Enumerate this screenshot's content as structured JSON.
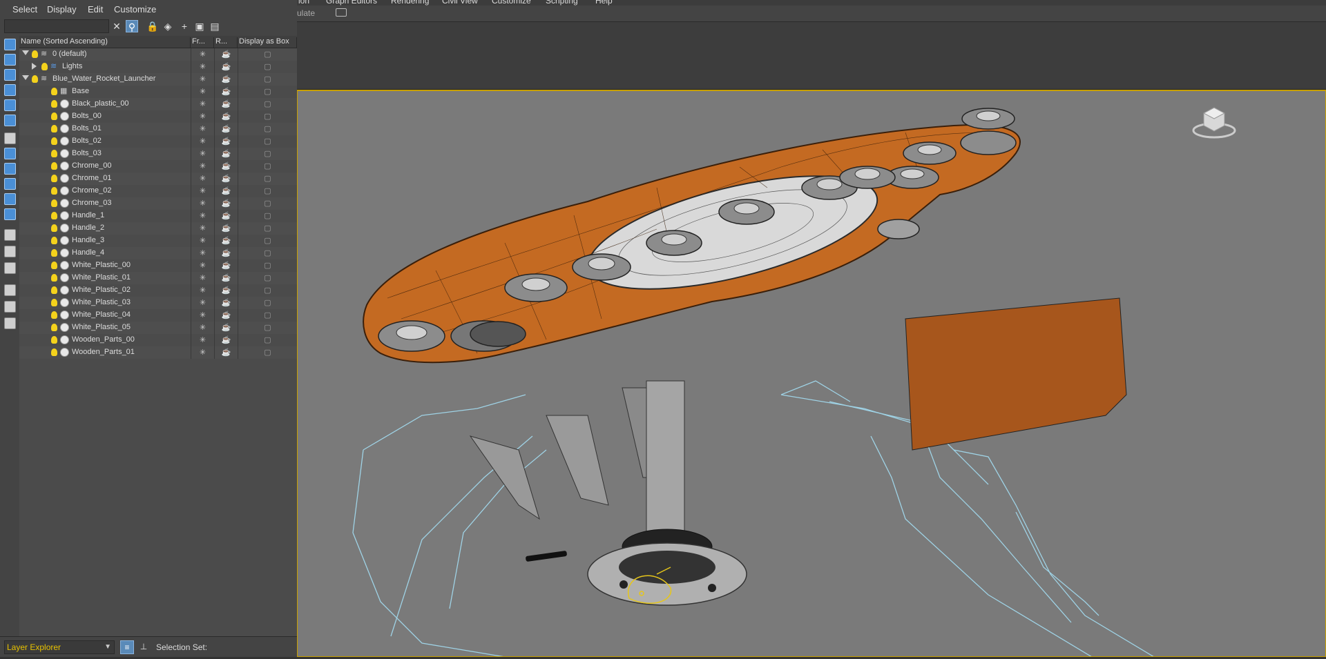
{
  "app_menu": [
    "ion",
    "Graph Editors",
    "Rendering",
    "Civil View",
    "Customize",
    "Scripting",
    "Help"
  ],
  "app_toolbar": {
    "label": "ulate"
  },
  "explorer": {
    "menu": [
      "Select",
      "Display",
      "Edit",
      "Customize"
    ],
    "search_value": "",
    "columns": [
      "Name (Sorted Ascending)",
      "Fr...",
      "R...",
      "Display as Box"
    ],
    "rows": [
      {
        "name": "0 (default)",
        "level": 0,
        "expand": "down",
        "kind": "layer"
      },
      {
        "name": "Lights",
        "level": 1,
        "expand": "right",
        "kind": "layer-blue"
      },
      {
        "name": "Blue_Water_Rocket_Launcher",
        "level": 0,
        "expand": "down",
        "kind": "layer"
      },
      {
        "name": "Base",
        "level": 2,
        "expand": "",
        "kind": "group"
      },
      {
        "name": "Black_plastic_00",
        "level": 2,
        "expand": "",
        "kind": "object"
      },
      {
        "name": "Bolts_00",
        "level": 2,
        "expand": "",
        "kind": "object"
      },
      {
        "name": "Bolts_01",
        "level": 2,
        "expand": "",
        "kind": "object"
      },
      {
        "name": "Bolts_02",
        "level": 2,
        "expand": "",
        "kind": "object"
      },
      {
        "name": "Bolts_03",
        "level": 2,
        "expand": "",
        "kind": "object"
      },
      {
        "name": "Chrome_00",
        "level": 2,
        "expand": "",
        "kind": "object"
      },
      {
        "name": "Chrome_01",
        "level": 2,
        "expand": "",
        "kind": "object"
      },
      {
        "name": "Chrome_02",
        "level": 2,
        "expand": "",
        "kind": "object"
      },
      {
        "name": "Chrome_03",
        "level": 2,
        "expand": "",
        "kind": "object"
      },
      {
        "name": "Handle_1",
        "level": 2,
        "expand": "",
        "kind": "object"
      },
      {
        "name": "Handle_2",
        "level": 2,
        "expand": "",
        "kind": "object"
      },
      {
        "name": "Handle_3",
        "level": 2,
        "expand": "",
        "kind": "object"
      },
      {
        "name": "Handle_4",
        "level": 2,
        "expand": "",
        "kind": "object"
      },
      {
        "name": "White_Plastic_00",
        "level": 2,
        "expand": "",
        "kind": "object"
      },
      {
        "name": "White_Plastic_01",
        "level": 2,
        "expand": "",
        "kind": "object"
      },
      {
        "name": "White_Plastic_02",
        "level": 2,
        "expand": "",
        "kind": "object"
      },
      {
        "name": "White_Plastic_03",
        "level": 2,
        "expand": "",
        "kind": "object"
      },
      {
        "name": "White_Plastic_04",
        "level": 2,
        "expand": "",
        "kind": "object"
      },
      {
        "name": "White_Plastic_05",
        "level": 2,
        "expand": "",
        "kind": "object"
      },
      {
        "name": "Wooden_Parts_00",
        "level": 2,
        "expand": "",
        "kind": "object"
      },
      {
        "name": "Wooden_Parts_01",
        "level": 2,
        "expand": "",
        "kind": "object"
      }
    ],
    "footer": {
      "combo": "Layer Explorer",
      "selection_label": "Selection Set:"
    }
  },
  "colors": {
    "viewport_bg": "#7a7a7a",
    "active_border": "#c8a000",
    "wood": "#c46a22",
    "accent": "#5a8ab8"
  }
}
